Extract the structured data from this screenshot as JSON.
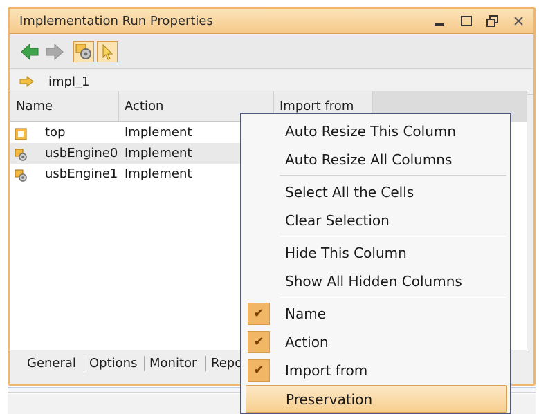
{
  "window": {
    "title": "Implementation Run Properties"
  },
  "path": {
    "label": "impl_1"
  },
  "table": {
    "columns": [
      "Name",
      "Action",
      "Import from"
    ],
    "rows": [
      {
        "name": "top",
        "action": "Implement",
        "icon": "module-icon"
      },
      {
        "name": "usbEngine0",
        "action": "Implement",
        "icon": "gear-module-icon"
      },
      {
        "name": "usbEngine1",
        "action": "Implement",
        "icon": "gear-module-icon"
      }
    ]
  },
  "tabs": [
    "General",
    "Options",
    "Monitor",
    "Repo"
  ],
  "context_menu": {
    "items": [
      {
        "label": "Auto Resize This Column",
        "checked": false,
        "highlighted": false
      },
      {
        "label": "Auto Resize All Columns",
        "checked": false,
        "highlighted": false
      },
      {
        "label": "Select All the Cells",
        "checked": false,
        "highlighted": false
      },
      {
        "label": "Clear Selection",
        "checked": false,
        "highlighted": false
      },
      {
        "label": "Hide This Column",
        "checked": false,
        "highlighted": false
      },
      {
        "label": "Show All Hidden Columns",
        "checked": false,
        "highlighted": false
      },
      {
        "label": "Name",
        "checked": true,
        "highlighted": false
      },
      {
        "label": "Action",
        "checked": true,
        "highlighted": false
      },
      {
        "label": "Import from",
        "checked": true,
        "highlighted": false
      },
      {
        "label": "Preservation",
        "checked": false,
        "highlighted": true
      }
    ]
  },
  "colors": {
    "accent": "#f6c98a",
    "menu_border": "#505882",
    "check_bg": "#f2b766"
  }
}
